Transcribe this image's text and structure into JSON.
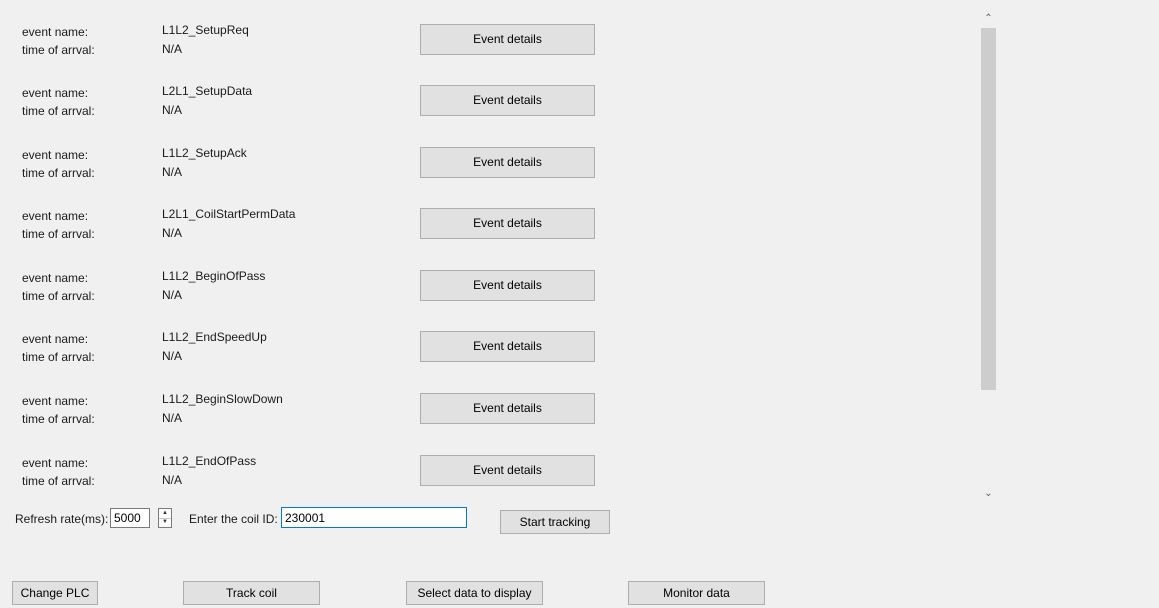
{
  "events": {
    "name_label": "event name:",
    "time_label": "time of arrval:",
    "details_label": "Event details",
    "items": [
      {
        "name": "L1L2_SetupReq",
        "time": "N/A"
      },
      {
        "name": "L2L1_SetupData",
        "time": "N/A"
      },
      {
        "name": "L1L2_SetupAck",
        "time": "N/A"
      },
      {
        "name": "L2L1_CoilStartPermData",
        "time": "N/A"
      },
      {
        "name": "L1L2_BeginOfPass",
        "time": "N/A"
      },
      {
        "name": "L1L2_EndSpeedUp",
        "time": "N/A"
      },
      {
        "name": "L1L2_BeginSlowDown",
        "time": "N/A"
      },
      {
        "name": "L1L2_EndOfPass",
        "time": "N/A"
      }
    ]
  },
  "tracking": {
    "refresh_label": "Refresh rate(ms):",
    "refresh_value": "5000",
    "coil_label": "Enter the coil ID:",
    "coil_value": "230001",
    "start_label": "Start tracking"
  },
  "bottom": {
    "change_plc": "Change PLC",
    "track_coil": "Track coil",
    "select_data": "Select data to display",
    "monitor_data": "Monitor data"
  },
  "icons": {
    "scroll_up": "chevron-up-icon",
    "scroll_down": "chevron-down-icon",
    "spin_up": "triangle-up-icon",
    "spin_down": "triangle-down-icon"
  }
}
